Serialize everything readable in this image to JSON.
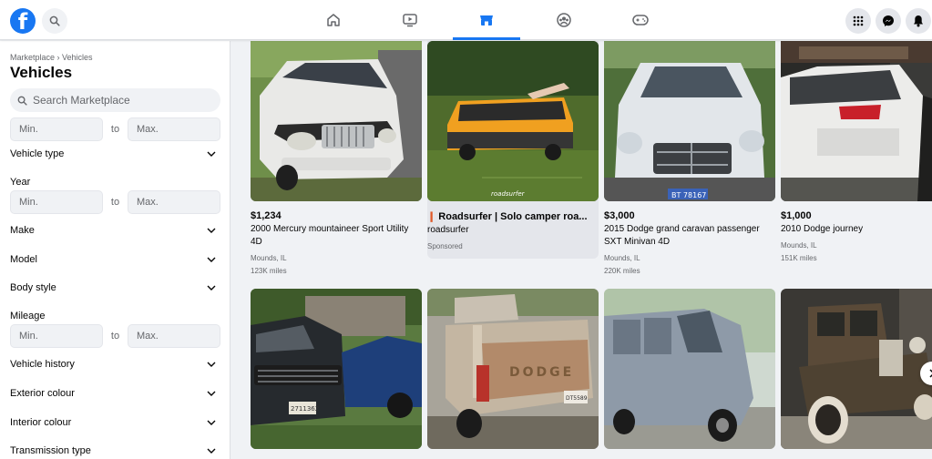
{
  "header": {
    "logo_letter": "f",
    "nav_tabs": [
      {
        "name": "home-icon",
        "active": false
      },
      {
        "name": "video-icon",
        "active": false
      },
      {
        "name": "marketplace-icon",
        "active": true
      },
      {
        "name": "groups-icon",
        "active": false
      },
      {
        "name": "gaming-icon",
        "active": false
      }
    ],
    "right_buttons": [
      "menu-grid-icon",
      "messenger-icon",
      "notifications-icon"
    ],
    "accent_color": "#1877f2"
  },
  "sidebar": {
    "breadcrumb": "Marketplace › Vehicles",
    "title": "Vehicles",
    "search_placeholder": "Search Marketplace",
    "price_range": {
      "min_placeholder": "Min.",
      "to": "to",
      "max_placeholder": "Max."
    },
    "year_label": "Year",
    "year_range": {
      "min_placeholder": "Min.",
      "to": "to",
      "max_placeholder": "Max."
    },
    "mileage_label": "Mileage",
    "mileage_range": {
      "min_placeholder": "Min.",
      "to": "to",
      "max_placeholder": "Max."
    },
    "filters": {
      "vehicle_type": "Vehicle type",
      "make": "Make",
      "model": "Model",
      "body_style": "Body style",
      "vehicle_history": "Vehicle history",
      "exterior_colour": "Exterior colour",
      "interior_colour": "Interior colour",
      "transmission_type": "Transmission type"
    }
  },
  "listings": [
    {
      "price": "$1,234",
      "title": "2000 Mercury mountaineer Sport Utility 4D",
      "location": "Mounds, IL",
      "mileage": "123K miles"
    },
    {
      "ad": true,
      "title": "Roadsurfer | Solo camper roa...",
      "advertiser": "roadsurfer",
      "sponsored": "Sponsored",
      "image_text": "roadsurfer"
    },
    {
      "price": "$3,000",
      "title": "2015 Dodge grand caravan passenger SXT Minivan 4D",
      "location": "Mounds, IL",
      "mileage": "220K miles",
      "plate": "BT 78167"
    },
    {
      "price": "$1,000",
      "title": "2010 Dodge journey",
      "location": "Mounds, IL",
      "mileage": "151K miles"
    },
    {
      "plate": "2711362",
      "description": "black pickup truck"
    },
    {
      "tailgate_text": "DODGE",
      "plate": "DT5589"
    },
    {
      "description": "blue van"
    },
    {
      "description": "vintage car"
    }
  ]
}
